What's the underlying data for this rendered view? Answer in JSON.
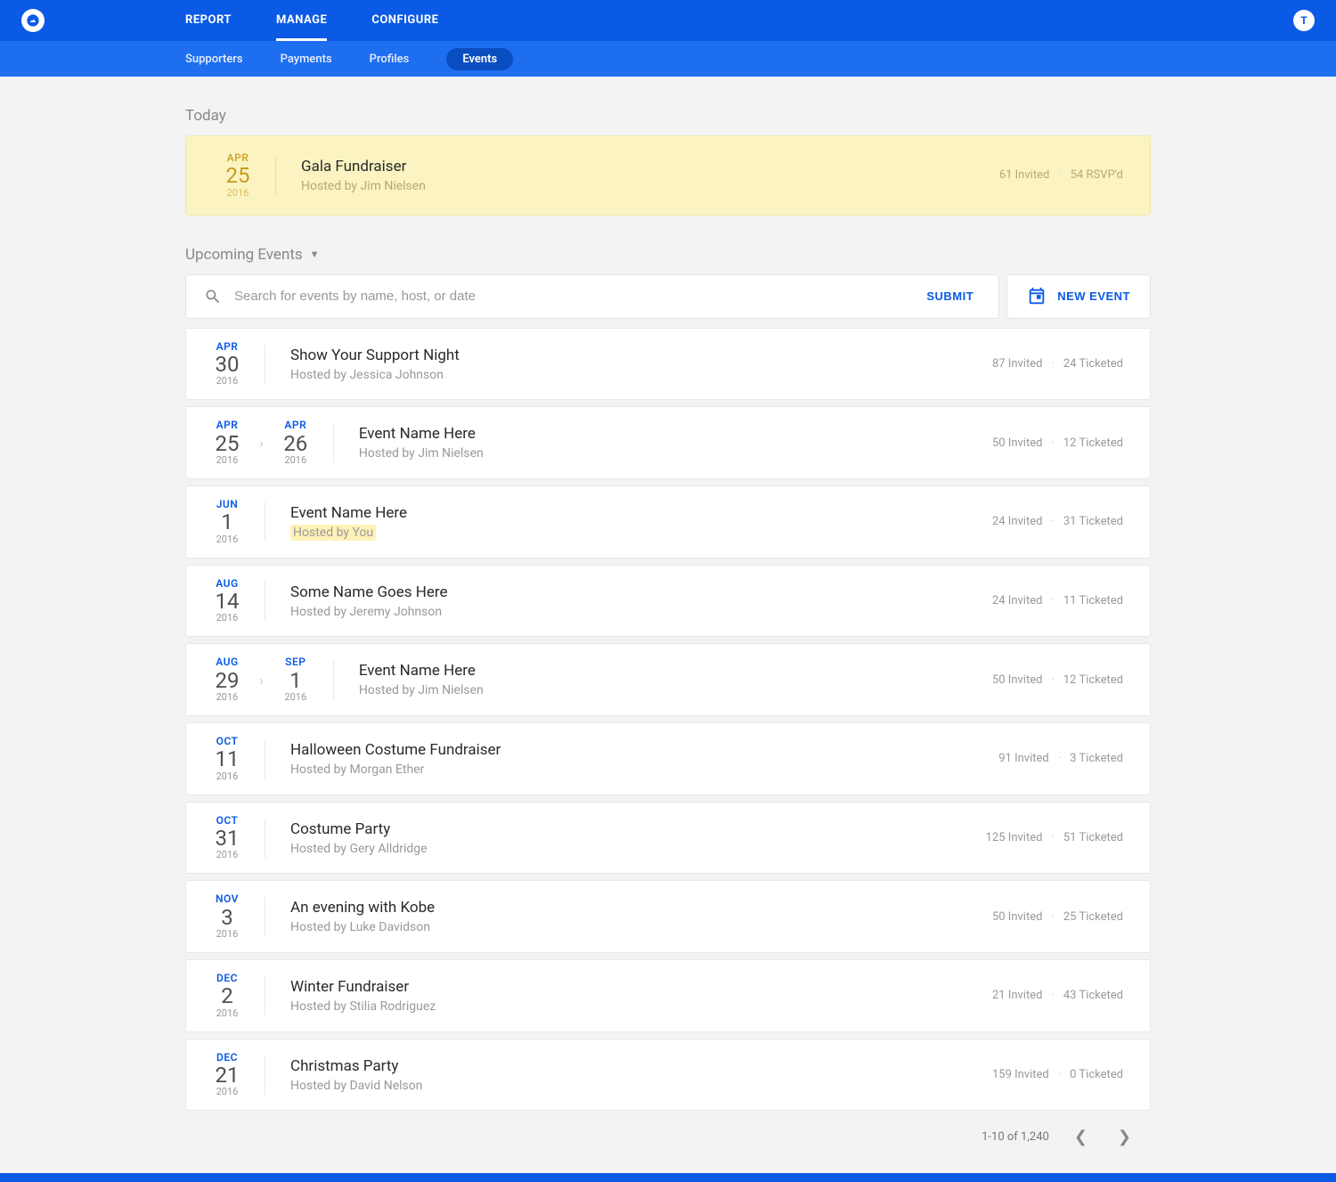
{
  "topnav": {
    "items": [
      "REPORT",
      "MANAGE",
      "CONFIGURE"
    ],
    "active": 1
  },
  "subnav": {
    "items": [
      "Supporters",
      "Payments",
      "Profiles",
      "Events"
    ],
    "active": 3
  },
  "avatar": "T",
  "today_label": "Today",
  "today_event": {
    "date": {
      "mon": "APR",
      "day": "25",
      "yr": "2016"
    },
    "title": "Gala Fundraiser",
    "host": "Hosted by Jim Nielsen",
    "stat1": "61 Invited",
    "stat2": "54 RSVP'd"
  },
  "upcoming_label": "Upcoming Events",
  "search": {
    "placeholder": "Search for events by name, host, or date",
    "submit": "SUBMIT"
  },
  "new_event_label": "NEW EVENT",
  "events": [
    {
      "dates": [
        {
          "mon": "APR",
          "day": "30",
          "yr": "2016"
        }
      ],
      "title": "Show Your Support Night",
      "host": "Hosted by Jessica Johnson",
      "hostHighlight": false,
      "stat1": "87 Invited",
      "stat2": "24 Ticketed"
    },
    {
      "dates": [
        {
          "mon": "APR",
          "day": "25",
          "yr": "2016"
        },
        {
          "mon": "APR",
          "day": "26",
          "yr": "2016"
        }
      ],
      "title": "Event Name Here",
      "host": "Hosted by Jim Nielsen",
      "hostHighlight": false,
      "stat1": "50 Invited",
      "stat2": "12 Ticketed"
    },
    {
      "dates": [
        {
          "mon": "JUN",
          "day": "1",
          "yr": "2016"
        }
      ],
      "title": "Event Name Here",
      "host": "Hosted by You",
      "hostHighlight": true,
      "stat1": "24 Invited",
      "stat2": "31 Ticketed"
    },
    {
      "dates": [
        {
          "mon": "AUG",
          "day": "14",
          "yr": "2016"
        }
      ],
      "title": "Some Name Goes Here",
      "host": "Hosted by Jeremy Johnson",
      "hostHighlight": false,
      "stat1": "24 Invited",
      "stat2": "11 Ticketed"
    },
    {
      "dates": [
        {
          "mon": "AUG",
          "day": "29",
          "yr": "2016"
        },
        {
          "mon": "SEP",
          "day": "1",
          "yr": "2016"
        }
      ],
      "title": "Event Name Here",
      "host": "Hosted by Jim Nielsen",
      "hostHighlight": false,
      "stat1": "50 Invited",
      "stat2": "12 Ticketed"
    },
    {
      "dates": [
        {
          "mon": "OCT",
          "day": "11",
          "yr": "2016"
        }
      ],
      "title": "Halloween Costume Fundraiser",
      "host": "Hosted by Morgan Ether",
      "hostHighlight": false,
      "stat1": "91 Invited",
      "stat2": "3 Ticketed"
    },
    {
      "dates": [
        {
          "mon": "OCT",
          "day": "31",
          "yr": "2016"
        }
      ],
      "title": "Costume Party",
      "host": "Hosted by Gery Alldridge",
      "hostHighlight": false,
      "stat1": "125 Invited",
      "stat2": "51 Ticketed"
    },
    {
      "dates": [
        {
          "mon": "NOV",
          "day": "3",
          "yr": "2016"
        }
      ],
      "title": "An evening with Kobe",
      "host": "Hosted by Luke Davidson",
      "hostHighlight": false,
      "stat1": "50 Invited",
      "stat2": "25 Ticketed"
    },
    {
      "dates": [
        {
          "mon": "DEC",
          "day": "2",
          "yr": "2016"
        }
      ],
      "title": "Winter Fundraiser",
      "host": "Hosted by Stilia Rodriguez",
      "hostHighlight": false,
      "stat1": "21 Invited",
      "stat2": "43 Ticketed"
    },
    {
      "dates": [
        {
          "mon": "DEC",
          "day": "21",
          "yr": "2016"
        }
      ],
      "title": "Christmas Party",
      "host": "Hosted by David Nelson",
      "hostHighlight": false,
      "stat1": "159 Invited",
      "stat2": "0 Ticketed"
    }
  ],
  "pagination": "1-10 of 1,240"
}
